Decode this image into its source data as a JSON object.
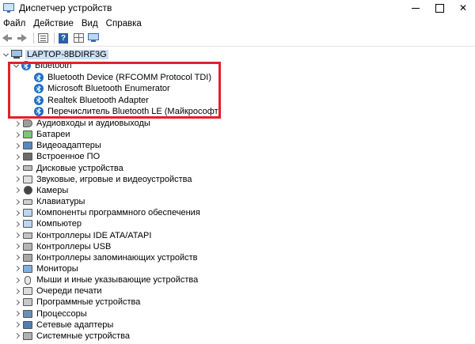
{
  "window": {
    "title": "Диспетчер устройств",
    "controls": {
      "minimize": "—",
      "maximize": "☐",
      "close": "✕"
    }
  },
  "menu": [
    "Файл",
    "Действие",
    "Вид",
    "Справка"
  ],
  "toolbar": {
    "buttons": [
      "back-icon",
      "forward-icon",
      "properties-icon",
      "help-icon",
      "grid-icon",
      "monitor-icon"
    ]
  },
  "tree": {
    "root": "LAPTOP-8BDIRF3G",
    "bluetooth": {
      "label": "Bluetooth",
      "children": [
        "Bluetooth Device (RFCOMM Protocol TDI)",
        "Microsoft Bluetooth Enumerator",
        "Realtek Bluetooth Adapter",
        "Перечислитель Bluetooth LE (Майкрософт)"
      ]
    },
    "categories": [
      "Аудиовходы и аудиовыходы",
      "Батареи",
      "Видеоадаптеры",
      "Встроенное ПО",
      "Дисковые устройства",
      "Звуковые, игровые и видеоустройства",
      "Камеры",
      "Клавиатуры",
      "Компоненты программного обеспечения",
      "Компьютер",
      "Контроллеры IDE ATA/ATAPI",
      "Контроллеры USB",
      "Контроллеры запоминающих устройств",
      "Мониторы",
      "Мыши и иные указывающие устройства",
      "Очереди печати",
      "Программные устройства",
      "Процессоры",
      "Сетевые адаптеры",
      "Системные устройства"
    ]
  },
  "colors": {
    "highlight": "#e3202a",
    "bluetooth": "#1f6fc4",
    "selection": "#cde0f5"
  }
}
